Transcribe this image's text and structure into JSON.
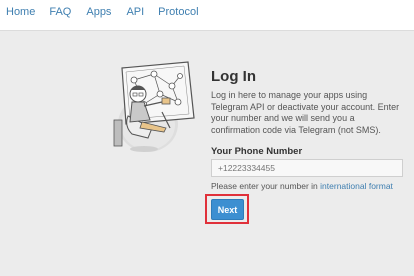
{
  "nav": {
    "items": [
      {
        "label": "Home"
      },
      {
        "label": "FAQ"
      },
      {
        "label": "Apps"
      },
      {
        "label": "API"
      },
      {
        "label": "Protocol"
      }
    ]
  },
  "login": {
    "title": "Log In",
    "description": "Log in here to manage your apps using Telegram API or deactivate your account. Enter your number and we will send you a confirmation code via Telegram (not SMS).",
    "phone_label": "Your Phone Number",
    "phone_placeholder": "+12223334455",
    "hint_prefix": "Please enter your number in ",
    "hint_link": "international format",
    "next_label": "Next"
  },
  "colors": {
    "link": "#3f7fb0",
    "button": "#3c8fd1",
    "highlight": "#e0303a",
    "background": "#ececec"
  },
  "icons": [
    "telegram-illustration"
  ]
}
